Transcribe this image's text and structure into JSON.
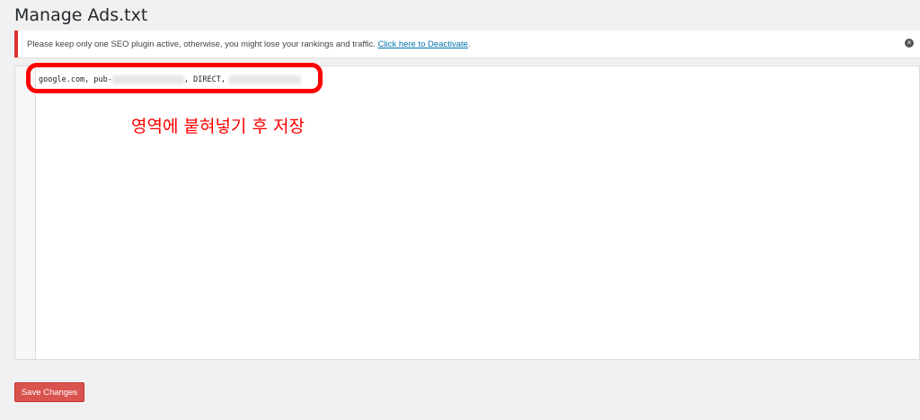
{
  "page": {
    "title": "Manage Ads.txt"
  },
  "notice": {
    "message": "Please keep only one SEO plugin active, otherwise, you might lose your rankings and traffic. ",
    "link_label": "Click here to Deactivate",
    "suffix": ".",
    "dismiss_icon": "close-circle-icon",
    "accent_color": "#dc3232"
  },
  "editor": {
    "line_prefix": "google.com, pub-",
    "line_middle": ", DIRECT, ",
    "redacted": true
  },
  "annotation": {
    "text": "영역에 붙혀넣기 후 저장",
    "color": "#ff0000"
  },
  "actions": {
    "save_label": "Save Changes",
    "save_color": "#d9534f"
  }
}
